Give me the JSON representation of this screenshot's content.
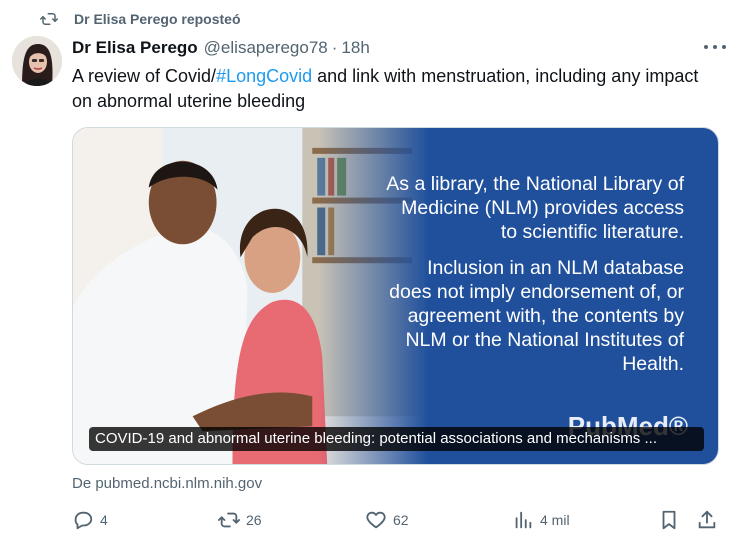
{
  "repost": {
    "label": "Dr Elisa Perego reposteó",
    "icon": "repost-icon"
  },
  "tweet": {
    "author_name": "Dr Elisa Perego",
    "handle": "@elisaperego78",
    "separator": "·",
    "time": "18h",
    "text_before": "A review of Covid/",
    "hashtag": "#LongCovid",
    "text_after": " and link with menstruation, including any impact on abnormal uterine bleeding"
  },
  "card": {
    "paragraph1": "As a library, the National Library of Medicine (NLM) provides access to scientific literature.",
    "paragraph2": "Inclusion in an NLM database does not imply endorsement of, or agreement with, the contents by NLM or the National Institutes of Health.",
    "logo_text": "PubMed®",
    "caption": "COVID-19 and abnormal uterine bleeding: potential associations and mechanisms ...",
    "source": "De pubmed.ncbi.nlm.nih.gov",
    "background_color": "#20509c"
  },
  "actions": {
    "replies": "4",
    "reposts": "26",
    "likes": "62",
    "views": "4 mil"
  },
  "colors": {
    "accent": "#1d9bf0",
    "muted": "#536471",
    "text": "#0f1419"
  }
}
